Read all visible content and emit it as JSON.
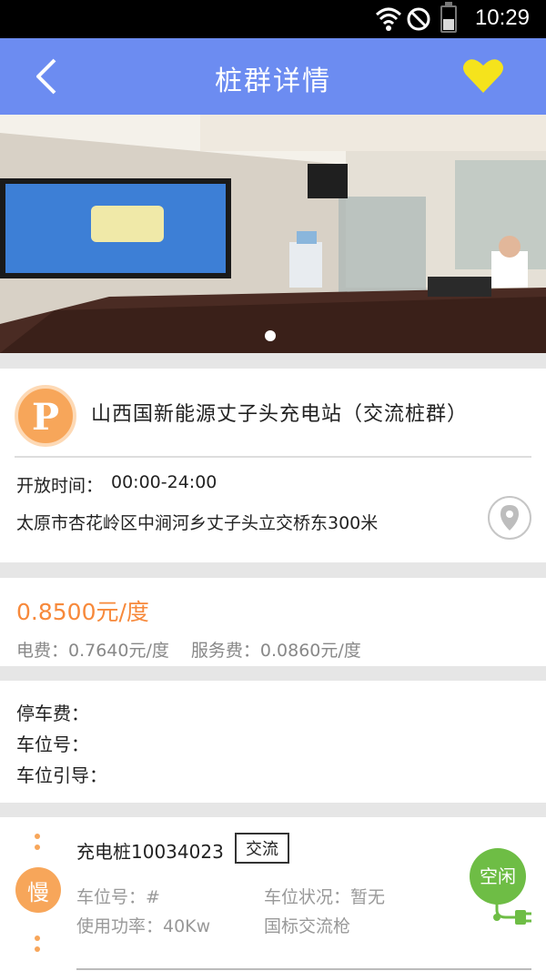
{
  "statusbar": {
    "time": "10:29",
    "icons": [
      "wifi-icon",
      "do-not-disturb-icon",
      "battery-icon"
    ]
  },
  "navbar": {
    "title": "桩群详情",
    "back_icon": "back-arrow-icon",
    "favorite_icon": "heart-icon",
    "favorite_color": "#f5e31c",
    "bg_color": "#6c8cf1"
  },
  "banner": {
    "image": "meeting-room-photo",
    "pager_dots": 1
  },
  "station": {
    "logo_letter": "P",
    "name": "山西国新能源丈子头充电站（交流桩群）",
    "hours_label": "开放时间：",
    "hours": "00:00-24:00",
    "address": "太原市杏花岭区中涧河乡丈子头立交桥东300米",
    "location_icon": "location-pin-icon"
  },
  "price": {
    "total": "0.8500元/度",
    "electricity": "电费：0.7640元/度",
    "service": "服务费：0.0860元/度",
    "accent_color": "#f7893b"
  },
  "parking": {
    "fee_label": "停车费：",
    "space_label": "车位号：",
    "guide_label": "车位引导："
  },
  "pile": {
    "speed": "慢",
    "id": "充电桩10034023",
    "type": "交流",
    "slot": "车位号：#",
    "slot_status": "车位状况：暂无",
    "power": "使用功率：40Kw",
    "gun": "国标交流枪",
    "state": "空闲",
    "state_color": "#6ebd45"
  }
}
